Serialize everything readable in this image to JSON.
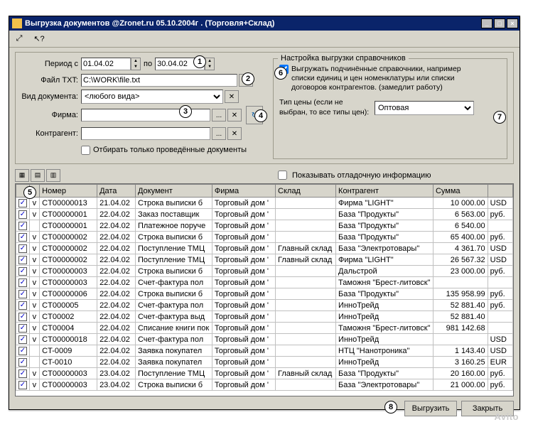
{
  "window": {
    "title": "Выгрузка документов  @Zronet.ru 05.10.2004г .  (Торговля+Склад)"
  },
  "filters": {
    "period_label": "Период с",
    "period_from": "01.04.02",
    "period_to_label": "по",
    "period_to": "30.04.02",
    "file_label": "Файл TXT:",
    "file_value": "C:\\WORK\\file.txt",
    "doc_type_label": "Вид документа:",
    "doc_type_value": "<любого вида>",
    "firm_label": "Фирма:",
    "firm_value": "",
    "contragent_label": "Контрагент:",
    "contragent_value": "",
    "only_posted_label": "Отбирать только проведённые документы"
  },
  "refs": {
    "group_title": "Настройка выгрузки справочников",
    "export_sub_label": "Выгружать подчинённые справочники, например списки единиц и цен номенклатуры или списки договоров контрагентов.  (замедлит работу)",
    "price_type_label": "Тип цены (если не выбран, то все типы цен):",
    "price_type_value": "Оптовая"
  },
  "debug": {
    "label": "Показывать отладочную информацию"
  },
  "columns": [
    "",
    "",
    "Номер",
    "Дата",
    "Документ",
    "Фирма",
    "Склад",
    "Контрагент",
    "Сумма",
    ""
  ],
  "rows": [
    {
      "c1": true,
      "c2": true,
      "num": "CT00000013",
      "date": "21.04.02",
      "doc": "Строка выписки б",
      "firm": "Торговый дом '",
      "sklad": "",
      "kontr": "Фирма \"LIGHT\"",
      "sum": "10 000.00",
      "cur": "USD"
    },
    {
      "c1": true,
      "c2": true,
      "num": "CT00000001",
      "date": "22.04.02",
      "doc": "Заказ поставщик",
      "firm": "Торговый дом '",
      "sklad": "",
      "kontr": "База \"Продукты\"",
      "sum": "6 563.00",
      "cur": "руб."
    },
    {
      "c1": true,
      "c2": "",
      "num": "CT00000001",
      "date": "22.04.02",
      "doc": "Платежное поруче",
      "firm": "Торговый дом '",
      "sklad": "",
      "kontr": "База \"Продукты\"",
      "sum": "6 540.00",
      "cur": ""
    },
    {
      "c1": true,
      "c2": true,
      "num": "CT00000002",
      "date": "22.04.02",
      "doc": "Строка выписки б",
      "firm": "Торговый дом '",
      "sklad": "",
      "kontr": "База \"Продукты\"",
      "sum": "65 400.00",
      "cur": "руб."
    },
    {
      "c1": true,
      "c2": true,
      "num": "CT00000002",
      "date": "22.04.02",
      "doc": "Поступление ТМЦ",
      "firm": "Торговый дом '",
      "sklad": "Главный склад",
      "kontr": "База \"Электротовары\"",
      "sum": "4 361.70",
      "cur": "USD"
    },
    {
      "c1": true,
      "c2": true,
      "num": "CT00000002",
      "date": "22.04.02",
      "doc": "Поступление ТМЦ",
      "firm": "Торговый дом '",
      "sklad": "Главный склад",
      "kontr": "Фирма \"LIGHT\"",
      "sum": "26 567.32",
      "cur": "USD"
    },
    {
      "c1": true,
      "c2": true,
      "num": "CT00000003",
      "date": "22.04.02",
      "doc": "Строка выписки б",
      "firm": "Торговый дом '",
      "sklad": "",
      "kontr": "Дальстрой",
      "sum": "23 000.00",
      "cur": "руб."
    },
    {
      "c1": true,
      "c2": true,
      "num": "CT00000003",
      "date": "22.04.02",
      "doc": "Счет-фактура пол",
      "firm": "Торговый дом '",
      "sklad": "",
      "kontr": "Таможня \"Брест-литовск\"",
      "sum": "",
      "cur": ""
    },
    {
      "c1": true,
      "c2": true,
      "num": "CT00000006",
      "date": "22.04.02",
      "doc": "Строка выписки б",
      "firm": "Торговый дом '",
      "sklad": "",
      "kontr": "База \"Продукты\"",
      "sum": "135 958.99",
      "cur": "руб."
    },
    {
      "c1": true,
      "c2": true,
      "num": "CT000005",
      "date": "22.04.02",
      "doc": "Счет-фактура пол",
      "firm": "Торговый дом '",
      "sklad": "",
      "kontr": "ИнноТрейд",
      "sum": "52 881.40",
      "cur": "руб."
    },
    {
      "c1": true,
      "c2": true,
      "num": "CT00002",
      "date": "22.04.02",
      "doc": "Счет-фактура выд",
      "firm": "Торговый дом '",
      "sklad": "",
      "kontr": "ИнноТрейд",
      "sum": "52 881.40",
      "cur": ""
    },
    {
      "c1": true,
      "c2": true,
      "num": "CT00004",
      "date": "22.04.02",
      "doc": "Списание книги пок",
      "firm": "Торговый дом '",
      "sklad": "",
      "kontr": "Таможня \"Брест-литовск\"",
      "sum": "981 142.68",
      "cur": ""
    },
    {
      "c1": true,
      "c2": true,
      "num": "CT00000018",
      "date": "22.04.02",
      "doc": "Счет-фактура пол",
      "firm": "Торговый дом '",
      "sklad": "",
      "kontr": "ИнноТрейд",
      "sum": "",
      "cur": "USD"
    },
    {
      "c1": true,
      "c2": "",
      "num": "CT-0009",
      "date": "22.04.02",
      "doc": "Заявка покупател",
      "firm": "Торговый дом '",
      "sklad": "",
      "kontr": "НТЦ \"Нанотроника\"",
      "sum": "1 143.40",
      "cur": "USD"
    },
    {
      "c1": true,
      "c2": "",
      "num": "CT-0010",
      "date": "22.04.02",
      "doc": "Заявка покупател",
      "firm": "Торговый дом '",
      "sklad": "",
      "kontr": "ИнноТрейд",
      "sum": "3 160.25",
      "cur": "EUR"
    },
    {
      "c1": true,
      "c2": true,
      "num": "CT00000003",
      "date": "23.04.02",
      "doc": "Поступление ТМЦ",
      "firm": "Торговый дом '",
      "sklad": "Главный склад",
      "kontr": "База \"Продукты\"",
      "sum": "20 160.00",
      "cur": "руб."
    },
    {
      "c1": true,
      "c2": true,
      "num": "CT00000003",
      "date": "23.04.02",
      "doc": "Строка выписки б",
      "firm": "Торговый дом '",
      "sklad": "",
      "kontr": "База \"Электротовары\"",
      "sum": "21 000.00",
      "cur": "руб."
    }
  ],
  "footer": {
    "export": "Выгрузить",
    "close": "Закрыть"
  },
  "callouts": {
    "1": "1",
    "2": "2",
    "3": "3",
    "4": "4",
    "5": "5",
    "6": "6",
    "7": "7",
    "8": "8"
  },
  "watermark": "Avito"
}
